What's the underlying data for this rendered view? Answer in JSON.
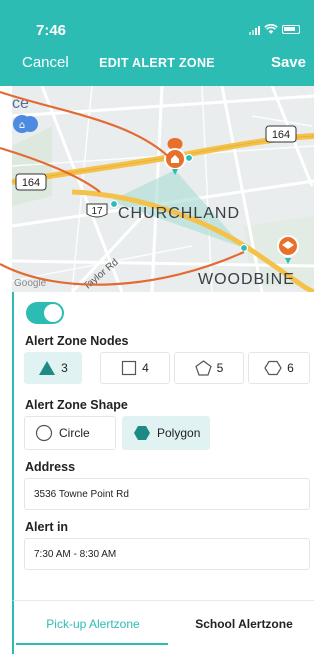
{
  "status_bar": {
    "time": "7:46"
  },
  "nav": {
    "cancel_label": "Cancel",
    "title": "EDIT ALERT ZONE",
    "save_label": "Save"
  },
  "map": {
    "labels": {
      "top_left_fragment": "ce",
      "churchland": "CHURCHLAND",
      "woodbine": "WOODBINE",
      "road": "Taylor Rd",
      "google": "Google"
    },
    "route_shields": {
      "a": "164",
      "b": "164",
      "c": "17"
    }
  },
  "form": {
    "toggle_on": true,
    "nodes_label": "Alert Zone Nodes",
    "nodes": [
      {
        "count": "3",
        "icon": "triangle-icon",
        "selected": true
      },
      {
        "count": "4",
        "icon": "square-icon",
        "selected": false
      },
      {
        "count": "5",
        "icon": "pentagon-icon",
        "selected": false
      },
      {
        "count": "6",
        "icon": "hexagon-icon",
        "selected": false
      }
    ],
    "shape_label": "Alert Zone Shape",
    "shapes": [
      {
        "label": "Circle",
        "icon": "circle-icon",
        "selected": false
      },
      {
        "label": "Polygon",
        "icon": "hexagon-filled-icon",
        "selected": true
      }
    ],
    "address_label": "Address",
    "address_value": "3536 Towne Point Rd",
    "alert_in_label": "Alert in",
    "alert_in_value": "7:30 AM - 8:30 AM"
  },
  "tabs": [
    {
      "label": "Pick-up Alertzone",
      "active": true
    },
    {
      "label": "School Alertzone",
      "active": false
    }
  ],
  "colors": {
    "accent": "#2cbcb4",
    "marker": "#e8702a",
    "highway": "#f4c24a"
  }
}
